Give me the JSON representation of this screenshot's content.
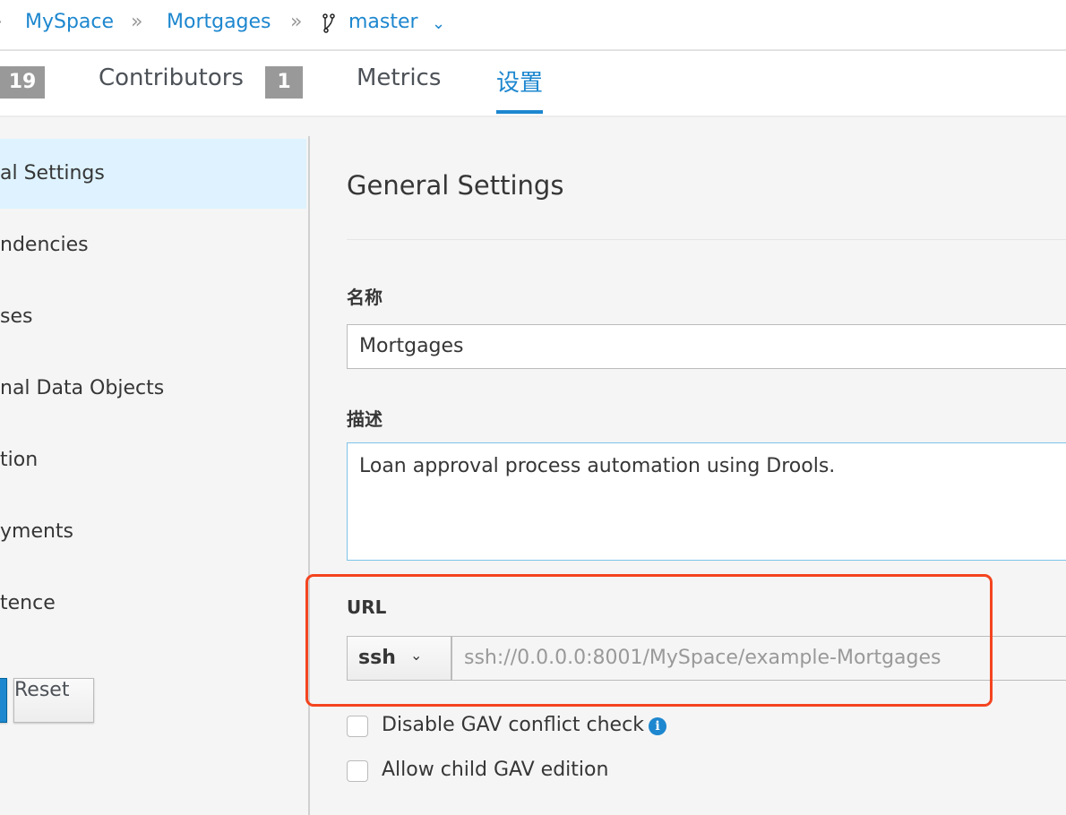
{
  "breadcrumb": {
    "items": [
      "MySpace",
      "Mortgages"
    ],
    "branch": "master",
    "separator": "»"
  },
  "tabs": [
    {
      "badge": "19"
    },
    {
      "label": "Contributors",
      "badge": "1"
    },
    {
      "label": "Metrics"
    },
    {
      "label": "设置",
      "active": true
    }
  ],
  "sidebar": {
    "items": [
      {
        "label": "al Settings",
        "active": true
      },
      {
        "label": "ndencies"
      },
      {
        "label": "ses"
      },
      {
        "label": "nal Data Objects"
      },
      {
        "label": "tion"
      },
      {
        "label": "yments"
      },
      {
        "label": "tence"
      }
    ],
    "reset_label": "Reset"
  },
  "main": {
    "title": "General Settings",
    "name_label": "名称",
    "name_value": "Mortgages",
    "desc_label": "描述",
    "desc_value": "Loan approval process automation using Drools.",
    "url_label": "URL",
    "protocol": "ssh",
    "url_value": "ssh://0.0.0.0:8001/MySpace/example-Mortgages",
    "checkboxes": [
      {
        "label": "Disable GAV conflict check",
        "checked": false
      },
      {
        "label": "Allow child GAV edition",
        "checked": false
      }
    ]
  },
  "colors": {
    "accent": "#1d87cf",
    "highlight": "#f4441f",
    "active_bg": "#def3ff"
  }
}
